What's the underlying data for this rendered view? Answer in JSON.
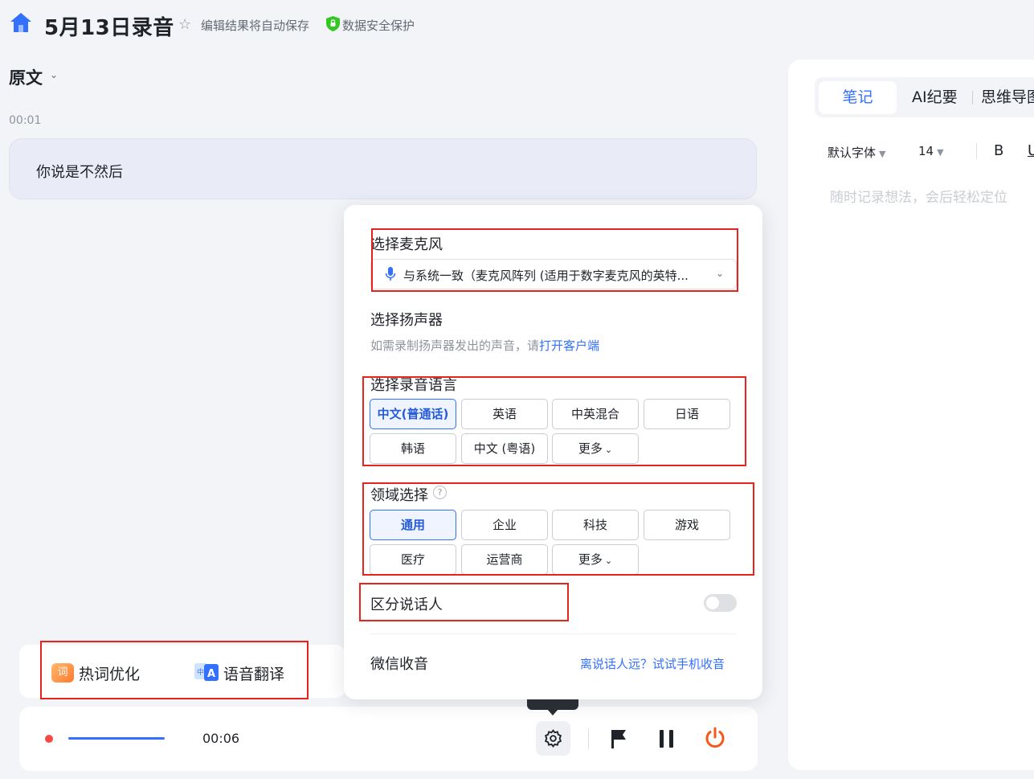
{
  "header": {
    "title": "5月13日录音",
    "autosave": "编辑结果将自动保存",
    "security": "数据安全保护"
  },
  "transcript": {
    "heading": "原文",
    "timestamp": "00:01",
    "text": "你说是不然后"
  },
  "tools": {
    "hotword_icon": "词",
    "hotword": "热词优化",
    "translate": "语音翻译"
  },
  "controls": {
    "elapsed": "00:06"
  },
  "notes": {
    "tabs": [
      "笔记",
      "AI纪要",
      "思维导图"
    ],
    "font": "默认字体",
    "size": "14",
    "bold": "B",
    "underline": "U",
    "placeholder": "随时记录想法，会后轻松定位"
  },
  "settings": {
    "mic_label": "选择麦克风",
    "mic_value": "与系统一致（麦克风阵列 (适用于数字麦克风的英特...",
    "speaker_label": "选择扬声器",
    "speaker_hint": "如需录制扬声器发出的声音，请",
    "speaker_link": "打开客户端",
    "lang_label": "选择录音语言",
    "languages": [
      "中文(普通话)",
      "英语",
      "中英混合",
      "日语",
      "韩语",
      "中文 (粤语)",
      "更多"
    ],
    "domain_label": "领域选择",
    "domains": [
      "通用",
      "企业",
      "科技",
      "游戏",
      "医疗",
      "运营商",
      "更多"
    ],
    "diarize_label": "区分说话人",
    "wechat_label": "微信收音",
    "wechat_link": "离说话人远？试试手机收音"
  },
  "colors": {
    "accent": "#3370ff",
    "annotation": "#e8231b",
    "stop": "#f5581b"
  }
}
